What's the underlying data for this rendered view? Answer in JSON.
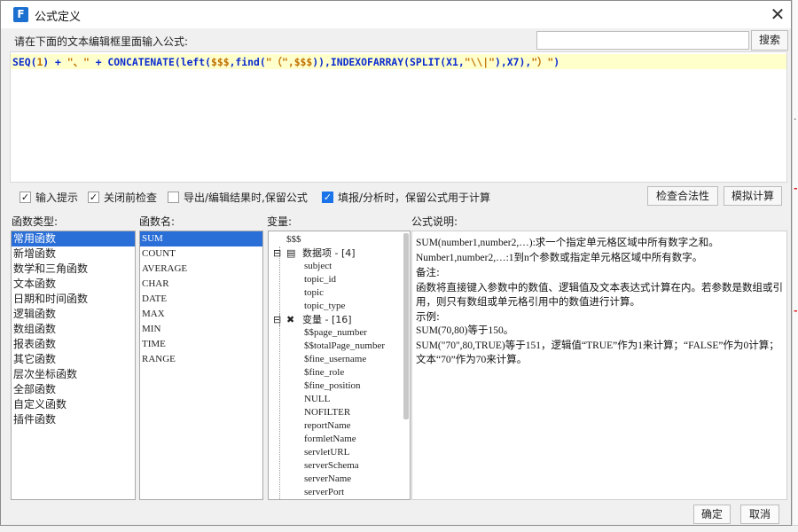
{
  "window": {
    "title": "公式定义",
    "close_glyph": "✕",
    "icon": "fine-report-app-icon"
  },
  "prompt": {
    "label": "请在下面的文本编辑框里面输入公式:",
    "search_placeholder": "",
    "search_button": "搜索"
  },
  "editor": {
    "formula_parts": [
      {
        "text": "SEQ(",
        "color": "blue"
      },
      {
        "text": "1",
        "color": "orange"
      },
      {
        "text": ") + ",
        "color": "blue"
      },
      {
        "text": "\"、\"",
        "color": "orange"
      },
      {
        "text": " + CONCATENATE(left(",
        "color": "blue"
      },
      {
        "text": "$$$",
        "color": "orange"
      },
      {
        "text": ",find(",
        "color": "blue"
      },
      {
        "text": "\"（\",$$$",
        "color": "orange"
      },
      {
        "text": ")),INDEXOFARRAY(SPLIT(X1,",
        "color": "blue"
      },
      {
        "text": "\"\\\\|\"",
        "color": "orange"
      },
      {
        "text": "),X7),",
        "color": "blue"
      },
      {
        "text": "\"）\"",
        "color": "orange"
      },
      {
        "text": ")",
        "color": "blue"
      }
    ]
  },
  "options": {
    "input_hint": {
      "label": "输入提示",
      "checked": true
    },
    "check_before_close": {
      "label": "关闭前检查",
      "checked": true
    },
    "keep_formula_export": {
      "label": "导出/编辑结果时,保留公式",
      "checked": false
    },
    "keep_formula_fill": {
      "label": "填报/分析时，保留公式用于计算",
      "checked": true
    },
    "validate_button": "检查合法性",
    "simulate_button": "模拟计算"
  },
  "labels": {
    "function_type": "函数类型:",
    "function_name": "函数名:",
    "variable": "变量:",
    "formula_desc": "公式说明:"
  },
  "function_types": [
    "常用函数",
    "新增函数",
    "数学和三角函数",
    "文本函数",
    "日期和时间函数",
    "逻辑函数",
    "数组函数",
    "报表函数",
    "其它函数",
    "层次坐标函数",
    "全部函数",
    "自定义函数",
    "插件函数"
  ],
  "function_names": [
    "SUM",
    "COUNT",
    "AVERAGE",
    "CHAR",
    "DATE",
    "MAX",
    "MIN",
    "TIME",
    "RANGE"
  ],
  "variables": {
    "root": "$$$",
    "data_items": {
      "label": "数据项 - [4]",
      "children": [
        "subject",
        "topic_id",
        "topic",
        "topic_type"
      ]
    },
    "vars": {
      "label": "变量 - [16]",
      "children": [
        "$$page_number",
        "$$totalPage_number",
        "$fine_username",
        "$fine_role",
        "$fine_position",
        "NULL",
        "NOFILTER",
        "reportName",
        "formletName",
        "servletURL",
        "serverSchema",
        "serverName",
        "serverPort"
      ]
    }
  },
  "description": {
    "line1": "SUM(number1,number2,…):求一个指定单元格区域中所有数字之和。",
    "line2": "Number1,number2,…:1到n个参数或指定单元格区域中所有数字。",
    "line3": "备注:",
    "line4": "函数将直接键入参数中的数值、逻辑值及文本表达式计算在内。若参数是数组或引用，则只有数组或单元格引用中的数值进行计算。",
    "line5": "示例:",
    "line6": "SUM(70,80)等于150。",
    "line7": "SUM(\"70\",80,TRUE)等于151，逻辑值“TRUE”作为1来计算；“FALSE”作为0计算；文本“70”作为70来计算。"
  },
  "footer": {
    "ok": "确定",
    "cancel": "取消"
  },
  "colors": {
    "selection": "#2a6fd8",
    "editor_highlight": "#ffffcc",
    "formula_blue": "#0a2bd0",
    "formula_orange": "#c07000"
  }
}
